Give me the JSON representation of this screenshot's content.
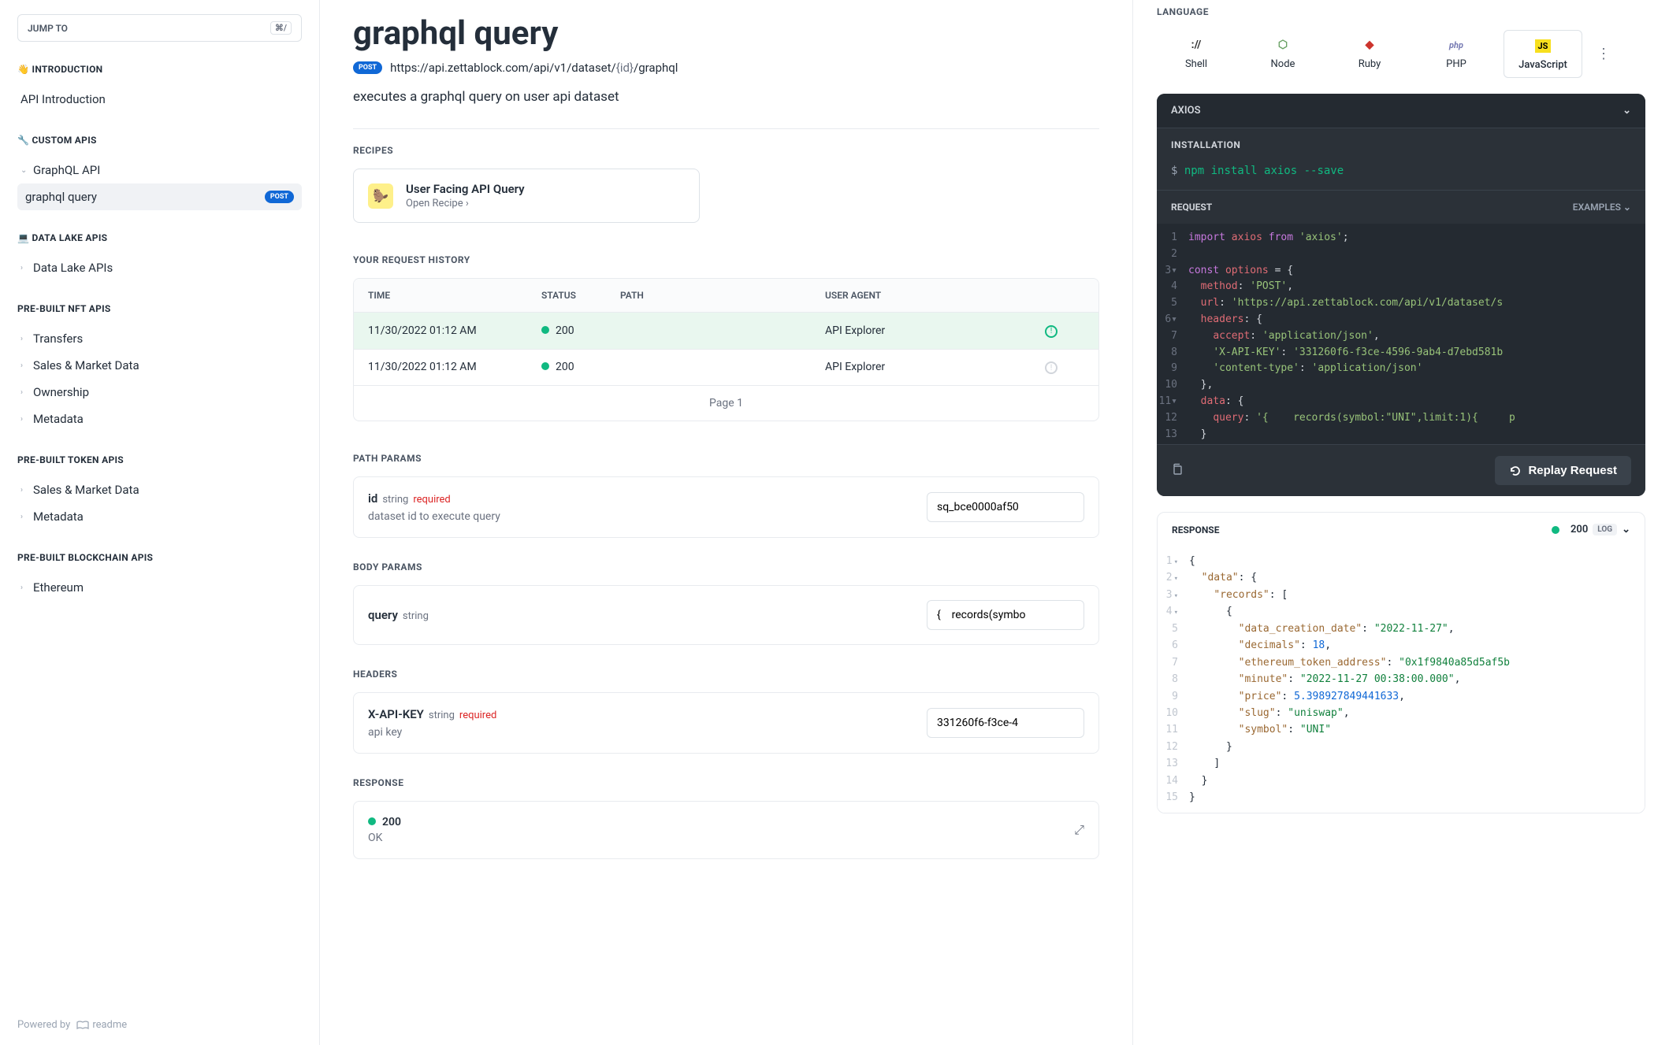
{
  "sidebar": {
    "jump_to": "JUMP TO",
    "shortcut": "⌘/",
    "sections": [
      {
        "heading": "👋 INTRODUCTION",
        "items": [
          {
            "label": "API Introduction"
          }
        ]
      },
      {
        "heading": "🔧 CUSTOM APIS",
        "items": [
          {
            "label": "GraphQL API",
            "expandable": true,
            "expanded": true
          },
          {
            "label": "graphql query",
            "active": true,
            "badge": "POST"
          }
        ]
      },
      {
        "heading": "💻 DATA LAKE APIS",
        "items": [
          {
            "label": "Data Lake APIs",
            "expandable": true
          }
        ]
      },
      {
        "heading": "PRE-BUILT NFT APIS",
        "items": [
          {
            "label": "Transfers",
            "expandable": true
          },
          {
            "label": "Sales & Market Data",
            "expandable": true
          },
          {
            "label": "Ownership",
            "expandable": true
          },
          {
            "label": "Metadata",
            "expandable": true
          }
        ]
      },
      {
        "heading": "PRE-BUILT TOKEN APIS",
        "items": [
          {
            "label": "Sales & Market Data",
            "expandable": true
          },
          {
            "label": "Metadata",
            "expandable": true
          }
        ]
      },
      {
        "heading": "PRE-BUILT BLOCKCHAIN APIS",
        "items": [
          {
            "label": "Ethereum",
            "expandable": true
          }
        ]
      }
    ],
    "powered": "Powered by",
    "powered_logo": "readme"
  },
  "main": {
    "title": "graphql query",
    "method": "POST",
    "url_base": "https://api.zettablock.com/api/v1/dataset/",
    "url_param": "{id}",
    "url_tail": "/graphql",
    "description": "executes a graphql query on user api dataset",
    "recipes_heading": "RECIPES",
    "recipe": {
      "title": "User Facing API Query",
      "sub": "Open Recipe",
      "icon": "🦫"
    },
    "history_heading": "YOUR REQUEST HISTORY",
    "history_cols": {
      "time": "TIME",
      "status": "STATUS",
      "path": "PATH",
      "ua": "USER AGENT"
    },
    "history_rows": [
      {
        "time": "11/30/2022 01:12 AM",
        "status": "200",
        "ua": "API Explorer",
        "active": true
      },
      {
        "time": "11/30/2022 01:12 AM",
        "status": "200",
        "ua": "API Explorer"
      }
    ],
    "history_page": "Page 1",
    "path_heading": "PATH PARAMS",
    "path_param": {
      "name": "id",
      "type": "string",
      "req": "required",
      "desc": "dataset id to execute query",
      "value": "sq_bce0000af50"
    },
    "body_heading": "BODY PARAMS",
    "body_param": {
      "name": "query",
      "type": "string",
      "value": "{    records(symbo"
    },
    "headers_heading": "HEADERS",
    "header_param": {
      "name": "X-API-KEY",
      "type": "string",
      "req": "required",
      "desc": "api key",
      "value": "331260f6-f3ce-4"
    },
    "response_heading": "RESPONSE",
    "response": {
      "code": "200",
      "ok": "OK"
    }
  },
  "right": {
    "lang_heading": "LANGUAGE",
    "langs": [
      {
        "label": "Shell",
        "icon": "://"
      },
      {
        "label": "Node",
        "icon": "⬡"
      },
      {
        "label": "Ruby",
        "icon": "◆"
      },
      {
        "label": "PHP",
        "icon": "php"
      },
      {
        "label": "JavaScript",
        "icon": "JS",
        "active": true
      }
    ],
    "axios_label": "AXIOS",
    "install_label": "INSTALLATION",
    "install_prompt": "$",
    "install_cmd": "npm install axios --save",
    "request_label": "REQUEST",
    "examples_label": "EXAMPLES",
    "replay_label": "Replay Request",
    "code_lines": [
      {
        "n": "1",
        "html": "<span class='tk-kw'>import</span> <span class='tk-var'>axios</span> <span class='tk-kw'>from</span> <span class='tk-str'>'axios'</span><span class='tk-pl'>;</span>"
      },
      {
        "n": "2",
        "html": ""
      },
      {
        "n": "3",
        "caret": true,
        "html": "<span class='tk-kw'>const</span> <span class='tk-var'>options</span> <span class='tk-pl'>= {</span>"
      },
      {
        "n": "4",
        "html": "  <span class='tk-var'>method</span><span class='tk-pl'>: </span><span class='tk-str'>'POST'</span><span class='tk-pl'>,</span>"
      },
      {
        "n": "5",
        "html": "  <span class='tk-var'>url</span><span class='tk-pl'>: </span><span class='tk-str'>'https://api.zettablock.com/api/v1/dataset/s</span>"
      },
      {
        "n": "6",
        "caret": true,
        "html": "  <span class='tk-var'>headers</span><span class='tk-pl'>: {</span>"
      },
      {
        "n": "7",
        "html": "    <span class='tk-var'>accept</span><span class='tk-pl'>: </span><span class='tk-str'>'application/json'</span><span class='tk-pl'>,</span>"
      },
      {
        "n": "8",
        "html": "    <span class='tk-str'>'X-API-KEY'</span><span class='tk-pl'>: </span><span class='tk-str'>'331260f6-f3ce-4596-9ab4-d7ebd581b</span>"
      },
      {
        "n": "9",
        "html": "    <span class='tk-str'>'content-type'</span><span class='tk-pl'>: </span><span class='tk-str'>'application/json'</span>"
      },
      {
        "n": "10",
        "html": "  <span class='tk-pl'>},</span>"
      },
      {
        "n": "11",
        "caret": true,
        "html": "  <span class='tk-var'>data</span><span class='tk-pl'>: {</span>"
      },
      {
        "n": "12",
        "html": "    <span class='tk-var'>query</span><span class='tk-pl'>: </span><span class='tk-str'>'{    records(symbol:\"UNI\",limit:1){     p</span>"
      },
      {
        "n": "13",
        "html": "  <span class='tk-pl'>}</span>"
      }
    ],
    "resp_label": "RESPONSE",
    "resp_status": "200",
    "resp_log": "LOG",
    "resp_lines": [
      {
        "n": "1",
        "caret": true,
        "html": "<span class='jp'>{</span>"
      },
      {
        "n": "2",
        "caret": true,
        "html": "  <span class='jk'>\"data\"</span><span class='jp'>: {</span>"
      },
      {
        "n": "3",
        "caret": true,
        "html": "    <span class='jk'>\"records\"</span><span class='jp'>: [</span>"
      },
      {
        "n": "4",
        "caret": true,
        "html": "      <span class='jp'>{</span>"
      },
      {
        "n": "5",
        "html": "        <span class='jk'>\"data_creation_date\"</span><span class='jp'>: </span><span class='js'>\"2022-11-27\"</span><span class='jp'>,</span>"
      },
      {
        "n": "6",
        "html": "        <span class='jk'>\"decimals\"</span><span class='jp'>: </span><span class='jn'>18</span><span class='jp'>,</span>"
      },
      {
        "n": "7",
        "html": "        <span class='jk'>\"ethereum_token_address\"</span><span class='jp'>: </span><span class='js'>\"0x1f9840a85d5af5b</span>"
      },
      {
        "n": "8",
        "html": "        <span class='jk'>\"minute\"</span><span class='jp'>: </span><span class='js'>\"2022-11-27 00:38:00.000\"</span><span class='jp'>,</span>"
      },
      {
        "n": "9",
        "html": "        <span class='jk'>\"price\"</span><span class='jp'>: </span><span class='jn'>5.398927849441633</span><span class='jp'>,</span>"
      },
      {
        "n": "10",
        "html": "        <span class='jk'>\"slug\"</span><span class='jp'>: </span><span class='js'>\"uniswap\"</span><span class='jp'>,</span>"
      },
      {
        "n": "11",
        "html": "        <span class='jk'>\"symbol\"</span><span class='jp'>: </span><span class='js'>\"UNI\"</span>"
      },
      {
        "n": "12",
        "html": "      <span class='jp'>}</span>"
      },
      {
        "n": "13",
        "html": "    <span class='jp'>]</span>"
      },
      {
        "n": "14",
        "html": "  <span class='jp'>}</span>"
      },
      {
        "n": "15",
        "html": "<span class='jp'>}</span>"
      }
    ]
  }
}
